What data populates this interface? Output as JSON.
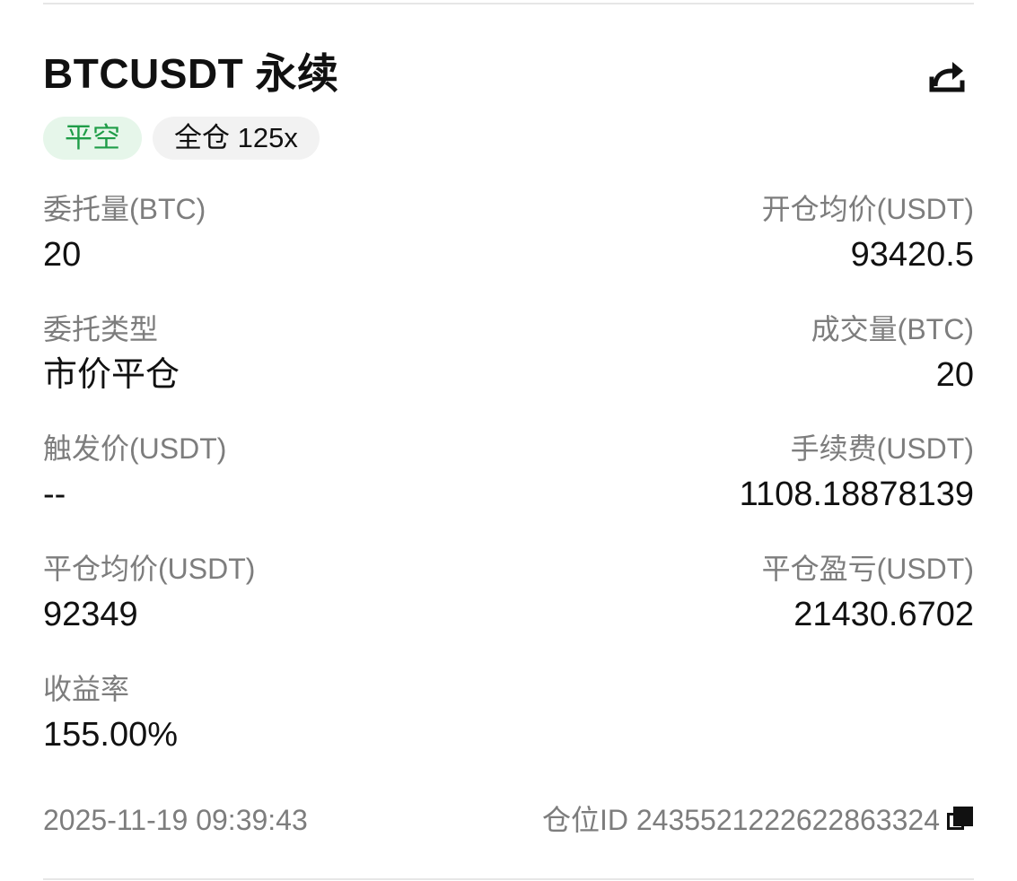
{
  "header": {
    "title": "BTCUSDT 永续",
    "share_icon": "share-icon"
  },
  "tags": {
    "side": "平空",
    "margin": "全仓 125x"
  },
  "fields": {
    "order_qty": {
      "label": "委托量(BTC)",
      "value": "20"
    },
    "open_avg_price": {
      "label": "开仓均价(USDT)",
      "value": "93420.5"
    },
    "order_type": {
      "label": "委托类型",
      "value": "市价平仓"
    },
    "filled_qty": {
      "label": "成交量(BTC)",
      "value": "20"
    },
    "trigger_price": {
      "label": "触发价(USDT)",
      "value": "--"
    },
    "fee": {
      "label": "手续费(USDT)",
      "value": "1108.18878139"
    },
    "close_avg_price": {
      "label": "平仓均价(USDT)",
      "value": "92349"
    },
    "close_pnl": {
      "label": "平仓盈亏(USDT)",
      "value": "21430.6702"
    },
    "roi": {
      "label": "收益率",
      "value": "155.00%"
    }
  },
  "footer": {
    "timestamp": "2025-11-19 09:39:43",
    "position_id_text": "仓位ID 2435521222622863324",
    "copy_icon": "copy-icon"
  },
  "colors": {
    "side_tag_text": "#1f9d48",
    "side_tag_bg": "#e6f6ea",
    "label_gray": "#7d7d7d",
    "value_dark": "#111111"
  }
}
